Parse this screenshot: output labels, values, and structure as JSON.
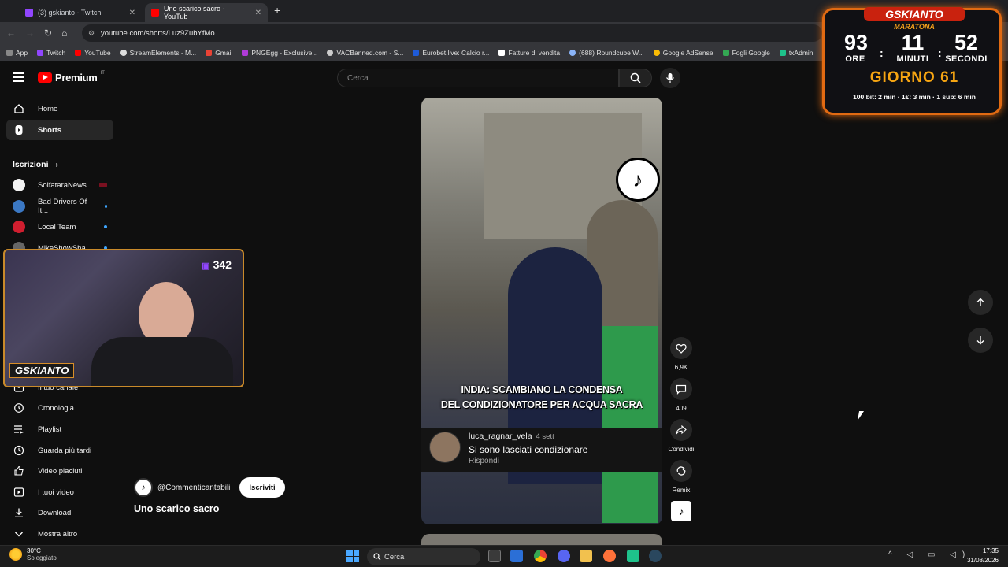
{
  "browser": {
    "tabs": [
      {
        "title": "(3) gskianto - Twitch",
        "color": "#9146ff"
      },
      {
        "title": "Uno scarico sacro - YouTub",
        "color": "#ff0000"
      }
    ],
    "new_tab": "+",
    "url": "youtube.com/shorts/Luz9ZubYfMo",
    "bookmarks": [
      {
        "label": "App",
        "color": "#888888"
      },
      {
        "label": "Twitch",
        "color": "#9146ff"
      },
      {
        "label": "YouTube",
        "color": "#ff0000"
      },
      {
        "label": "StreamElements - M...",
        "color": "#dddddd"
      },
      {
        "label": "Gmail",
        "color": "#ea4335"
      },
      {
        "label": "PNGEgg - Exclusive...",
        "color": "#b03bd8"
      },
      {
        "label": "VACBanned.com - S...",
        "color": "#cccccc"
      },
      {
        "label": "Eurobet.live: Calcio r...",
        "color": "#1e5bd8"
      },
      {
        "label": "Fatture di vendita",
        "color": "#ffffff"
      },
      {
        "label": "(688) Roundcube W...",
        "color": "#8ab4f8"
      },
      {
        "label": "Google AdSense",
        "color": "#fbbc04"
      },
      {
        "label": "Fogli Google",
        "color": "#34a853"
      },
      {
        "label": "txAdmin",
        "color": "#1ec28b"
      }
    ]
  },
  "youtube": {
    "logo_text": "Premium",
    "logo_country": "IT",
    "search_placeholder": "Cerca",
    "nav": [
      {
        "label": "Home",
        "icon": "home-icon"
      },
      {
        "label": "Shorts",
        "icon": "shorts-icon"
      }
    ],
    "subscriptions_heading": "Iscrizioni",
    "subscriptions": [
      {
        "label": "SolfataraNews",
        "color": "#ffffff",
        "indicator": "live-red"
      },
      {
        "label": "Bad Drivers Of It...",
        "color": "#3b78c4",
        "indicator": "dot"
      },
      {
        "label": "Local Team",
        "color": "#d01e2f",
        "indicator": "dot"
      },
      {
        "label": "MikeShowSha",
        "color": "#666666",
        "indicator": "dot"
      }
    ],
    "you_items": [
      {
        "label": "Il tuo canale",
        "icon": "channel-icon"
      },
      {
        "label": "Cronologia",
        "icon": "history-icon"
      },
      {
        "label": "Playlist",
        "icon": "playlist-icon"
      },
      {
        "label": "Guarda più tardi",
        "icon": "clock-icon"
      },
      {
        "label": "Video piaciuti",
        "icon": "thumbs-up-icon"
      },
      {
        "label": "I tuoi video",
        "icon": "video-icon"
      },
      {
        "label": "Download",
        "icon": "download-icon"
      },
      {
        "label": "Mostra altro",
        "icon": "chevron-down-icon"
      }
    ],
    "short": {
      "caption_line1": "INDIA: SCAMBIANO LA CONDENSA",
      "caption_line2": "DEL CONDIZIONATORE PER ACQUA SACRA",
      "channel": "@Commenticantabili",
      "subscribe_label": "Iscriviti",
      "title": "Uno scarico sacro"
    },
    "comment": {
      "user": "luca_ragnar_vela",
      "age": "4 sett",
      "text": "Si sono lasciati condizionare",
      "reply": "Rispondi"
    },
    "actions": {
      "likes": "6,9K",
      "comments": "409",
      "share": "Condividi",
      "remix": "Remix"
    }
  },
  "webcam": {
    "viewers": "342",
    "brand": "GSKIANTO"
  },
  "timer": {
    "brand": "GSKIANTO",
    "subtitle": "MARATONA",
    "hours": "93",
    "minutes": "11",
    "seconds": "52",
    "hours_label": "ORE",
    "minutes_label": "MINUTI",
    "seconds_label": "SECONDI",
    "day": "GIORNO 61",
    "rules": "100 bit: 2 min · 1€: 3 min · 1 sub: 6 min"
  },
  "taskbar": {
    "temperature": "30°C",
    "weather": "Soleggiato",
    "search": "Cerca",
    "time": "17:35",
    "date": "31/08/2026"
  }
}
